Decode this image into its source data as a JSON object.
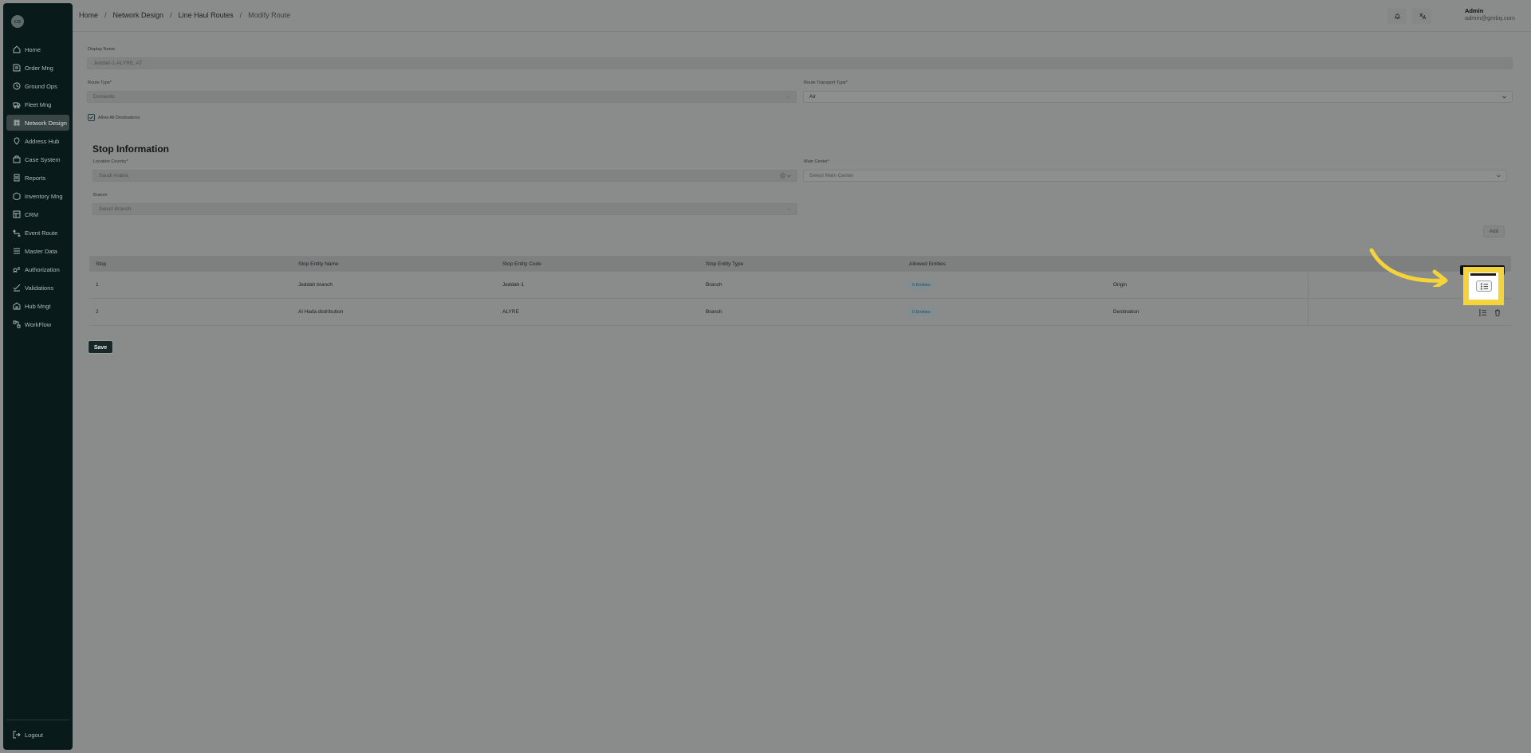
{
  "sidebar": {
    "logo_text": "co",
    "items": [
      {
        "label": "Home",
        "icon": "home-icon"
      },
      {
        "label": "Order Mng",
        "icon": "order-icon"
      },
      {
        "label": "Ground Ops",
        "icon": "ground-ops-icon"
      },
      {
        "label": "Fleet Mng",
        "icon": "fleet-icon"
      },
      {
        "label": "Network Design",
        "icon": "network-icon",
        "active": true
      },
      {
        "label": "Address Hub",
        "icon": "address-icon"
      },
      {
        "label": "Case System",
        "icon": "case-icon"
      },
      {
        "label": "Reports",
        "icon": "reports-icon"
      },
      {
        "label": "Inventory Mng",
        "icon": "inventory-icon"
      },
      {
        "label": "CRM",
        "icon": "crm-icon"
      },
      {
        "label": "Event Route",
        "icon": "event-route-icon"
      },
      {
        "label": "Master Data",
        "icon": "master-data-icon"
      },
      {
        "label": "Authorization",
        "icon": "authorization-icon"
      },
      {
        "label": "Validations",
        "icon": "validations-icon"
      },
      {
        "label": "Hub Mngt",
        "icon": "hub-icon"
      },
      {
        "label": "WorkFlow",
        "icon": "workflow-icon"
      }
    ],
    "logout_label": "Logout"
  },
  "header": {
    "breadcrumb": [
      "Home",
      "Network Design",
      "Line Haul Routes",
      "Modify Route"
    ],
    "user_name": "Admin",
    "user_email": "admin@gmbq.com"
  },
  "form": {
    "display_name_label": "Display Name",
    "display_name_value": "Jeddah-1-ALYRE, AT",
    "route_type_label": "Route Type",
    "route_type_value": "Domestic",
    "transport_type_label": "Route Transport Type",
    "transport_type_value": "Air",
    "allow_all_label": "Allow All Destinations"
  },
  "stop_info": {
    "title": "Stop Information",
    "location_country_label": "Location Country",
    "location_country_value": "Saudi Arabia",
    "main_center_label": "Main Center",
    "main_center_placeholder": "Select Main Center",
    "branch_label": "Branch",
    "branch_placeholder": "Select Branch",
    "add_label": "Add"
  },
  "table": {
    "headers": [
      "Stop",
      "Stop Entity Name",
      "Stop Entity Code",
      "Stop Entity Type",
      "Allowed Entities"
    ],
    "rows": [
      {
        "stop": "1",
        "name": "Jeddah branch",
        "code": "Jeddah-1",
        "type": "Branch",
        "entities": "0 Entities",
        "role": "Origin"
      },
      {
        "stop": "2",
        "name": "Al Hada distribution",
        "code": "ALYRE",
        "type": "Branch",
        "entities": "0 Entities",
        "role": "Destination"
      }
    ]
  },
  "save_label": "Save",
  "colors": {
    "sidebar_bg": "#091a1a",
    "highlight": "#f4d43a",
    "arrow": "#f4d43a"
  }
}
